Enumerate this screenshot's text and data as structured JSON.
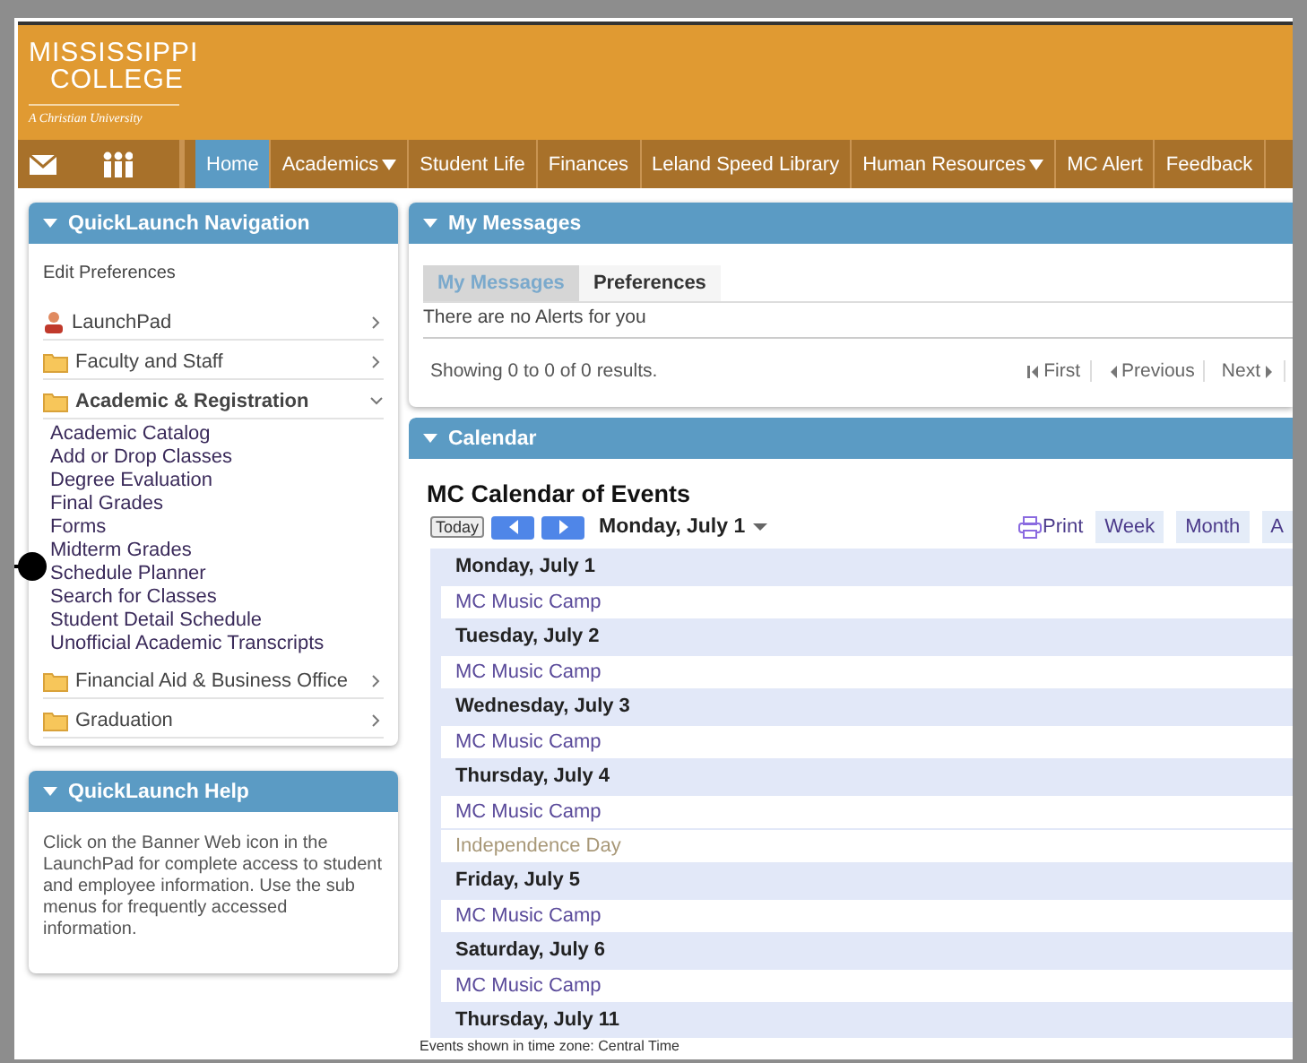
{
  "header": {
    "logo_line1": "MISSISSIPPI",
    "logo_line2": "COLLEGE",
    "tagline": "A Christian University"
  },
  "nav": {
    "items": [
      {
        "label": "Home",
        "selected": true,
        "has_menu": false
      },
      {
        "label": "Academics",
        "selected": false,
        "has_menu": true
      },
      {
        "label": "Student Life",
        "selected": false,
        "has_menu": false
      },
      {
        "label": "Finances",
        "selected": false,
        "has_menu": false
      },
      {
        "label": "Leland Speed Library",
        "selected": false,
        "has_menu": false
      },
      {
        "label": "Human Resources",
        "selected": false,
        "has_menu": true
      },
      {
        "label": "MC Alert",
        "selected": false,
        "has_menu": false
      },
      {
        "label": "Feedback",
        "selected": false,
        "has_menu": false
      }
    ]
  },
  "quicklaunch": {
    "title": "QuickLaunch Navigation",
    "edit": "Edit Preferences",
    "items": [
      {
        "label": "LaunchPad",
        "kind": "person",
        "expanded": false
      },
      {
        "label": "Faculty and Staff",
        "kind": "folder",
        "expanded": false
      },
      {
        "label": "Academic & Registration",
        "kind": "folder",
        "expanded": true,
        "children": [
          {
            "label": "Academic Catalog"
          },
          {
            "label": "Add or Drop Classes"
          },
          {
            "label": "Degree Evaluation"
          },
          {
            "label": "Final Grades"
          },
          {
            "label": "Forms"
          },
          {
            "label": "Midterm Grades"
          },
          {
            "label": "Schedule Planner"
          },
          {
            "label": "Search for Classes"
          },
          {
            "label": "Student Detail Schedule"
          },
          {
            "label": "Unofficial Academic Transcripts"
          }
        ]
      },
      {
        "label": "Financial Aid & Business Office",
        "kind": "folder",
        "expanded": false
      },
      {
        "label": "Graduation",
        "kind": "folder",
        "expanded": false
      }
    ]
  },
  "help": {
    "title": "QuickLaunch Help",
    "text": "Click on the Banner Web icon in the LaunchPad for complete access to student and employee information.  Use the sub menus for frequently accessed information."
  },
  "messages": {
    "title": "My Messages",
    "tabs": [
      {
        "label": "My Messages",
        "selected": true
      },
      {
        "label": "Preferences",
        "selected": false
      }
    ],
    "empty_text": "There are no Alerts for you",
    "results": "Showing 0 to 0 of 0 results.",
    "pager": [
      {
        "label": "First",
        "kind": "first"
      },
      {
        "label": "Previous",
        "kind": "prev"
      },
      {
        "label": "Next",
        "kind": "next"
      }
    ]
  },
  "calendar": {
    "title": "Calendar",
    "heading": "MC Calendar of Events",
    "today": "Today",
    "date": "Monday, July 1",
    "print": "Print",
    "views": [
      {
        "label": "Week",
        "selected": false
      },
      {
        "label": "Month",
        "selected": false
      },
      {
        "label": "A",
        "selected": false
      }
    ],
    "days": [
      {
        "date": "Monday, July 1",
        "events": [
          {
            "title": "MC Music Camp",
            "kind": "event"
          }
        ]
      },
      {
        "date": "Tuesday, July 2",
        "events": [
          {
            "title": "MC Music Camp",
            "kind": "event"
          }
        ]
      },
      {
        "date": "Wednesday, July 3",
        "events": [
          {
            "title": "MC Music Camp",
            "kind": "event"
          }
        ]
      },
      {
        "date": "Thursday, July 4",
        "events": [
          {
            "title": "MC Music Camp",
            "kind": "event"
          },
          {
            "title": "Independence Day",
            "kind": "holiday"
          }
        ]
      },
      {
        "date": "Friday, July 5",
        "events": [
          {
            "title": "MC Music Camp",
            "kind": "event"
          }
        ]
      },
      {
        "date": "Saturday, July 6",
        "events": [
          {
            "title": "MC Music Camp",
            "kind": "event"
          }
        ]
      },
      {
        "date": "Thursday, July 11"
      }
    ],
    "footer": "Events shown in time zone: Central Time"
  }
}
